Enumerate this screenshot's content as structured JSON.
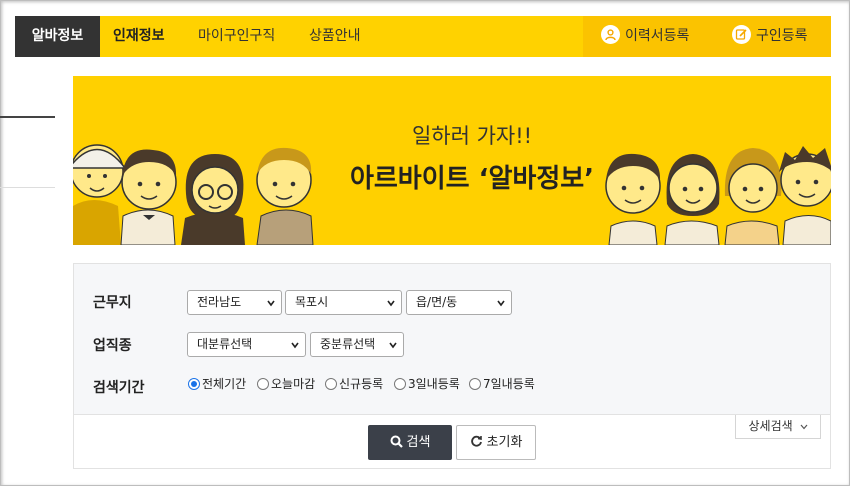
{
  "nav": {
    "tabs": [
      "알바정보",
      "인재정보",
      "마이구인구직",
      "상품안내"
    ],
    "resume_btn": "이력서등록",
    "hire_btn": "구인등록"
  },
  "banner": {
    "line1": "일하러 가자!!",
    "line2": "아르바이트 ‘알바정보’"
  },
  "search": {
    "location_label": "근무지",
    "location_selects": [
      "전라남도",
      "목포시",
      "읍/면/동"
    ],
    "job_label": "업직종",
    "job_selects": [
      "대분류선택",
      "중분류선택"
    ],
    "period_label": "검색기간",
    "period_options": [
      "전체기간",
      "오늘마감",
      "신규등록",
      "3일내등록",
      "7일내등록"
    ],
    "period_selected": "전체기간",
    "search_button": "검색",
    "reset_button": "초기화",
    "detail_button": "상세검색"
  },
  "colors": {
    "accent": "#ffd200",
    "dark": "#333333"
  }
}
